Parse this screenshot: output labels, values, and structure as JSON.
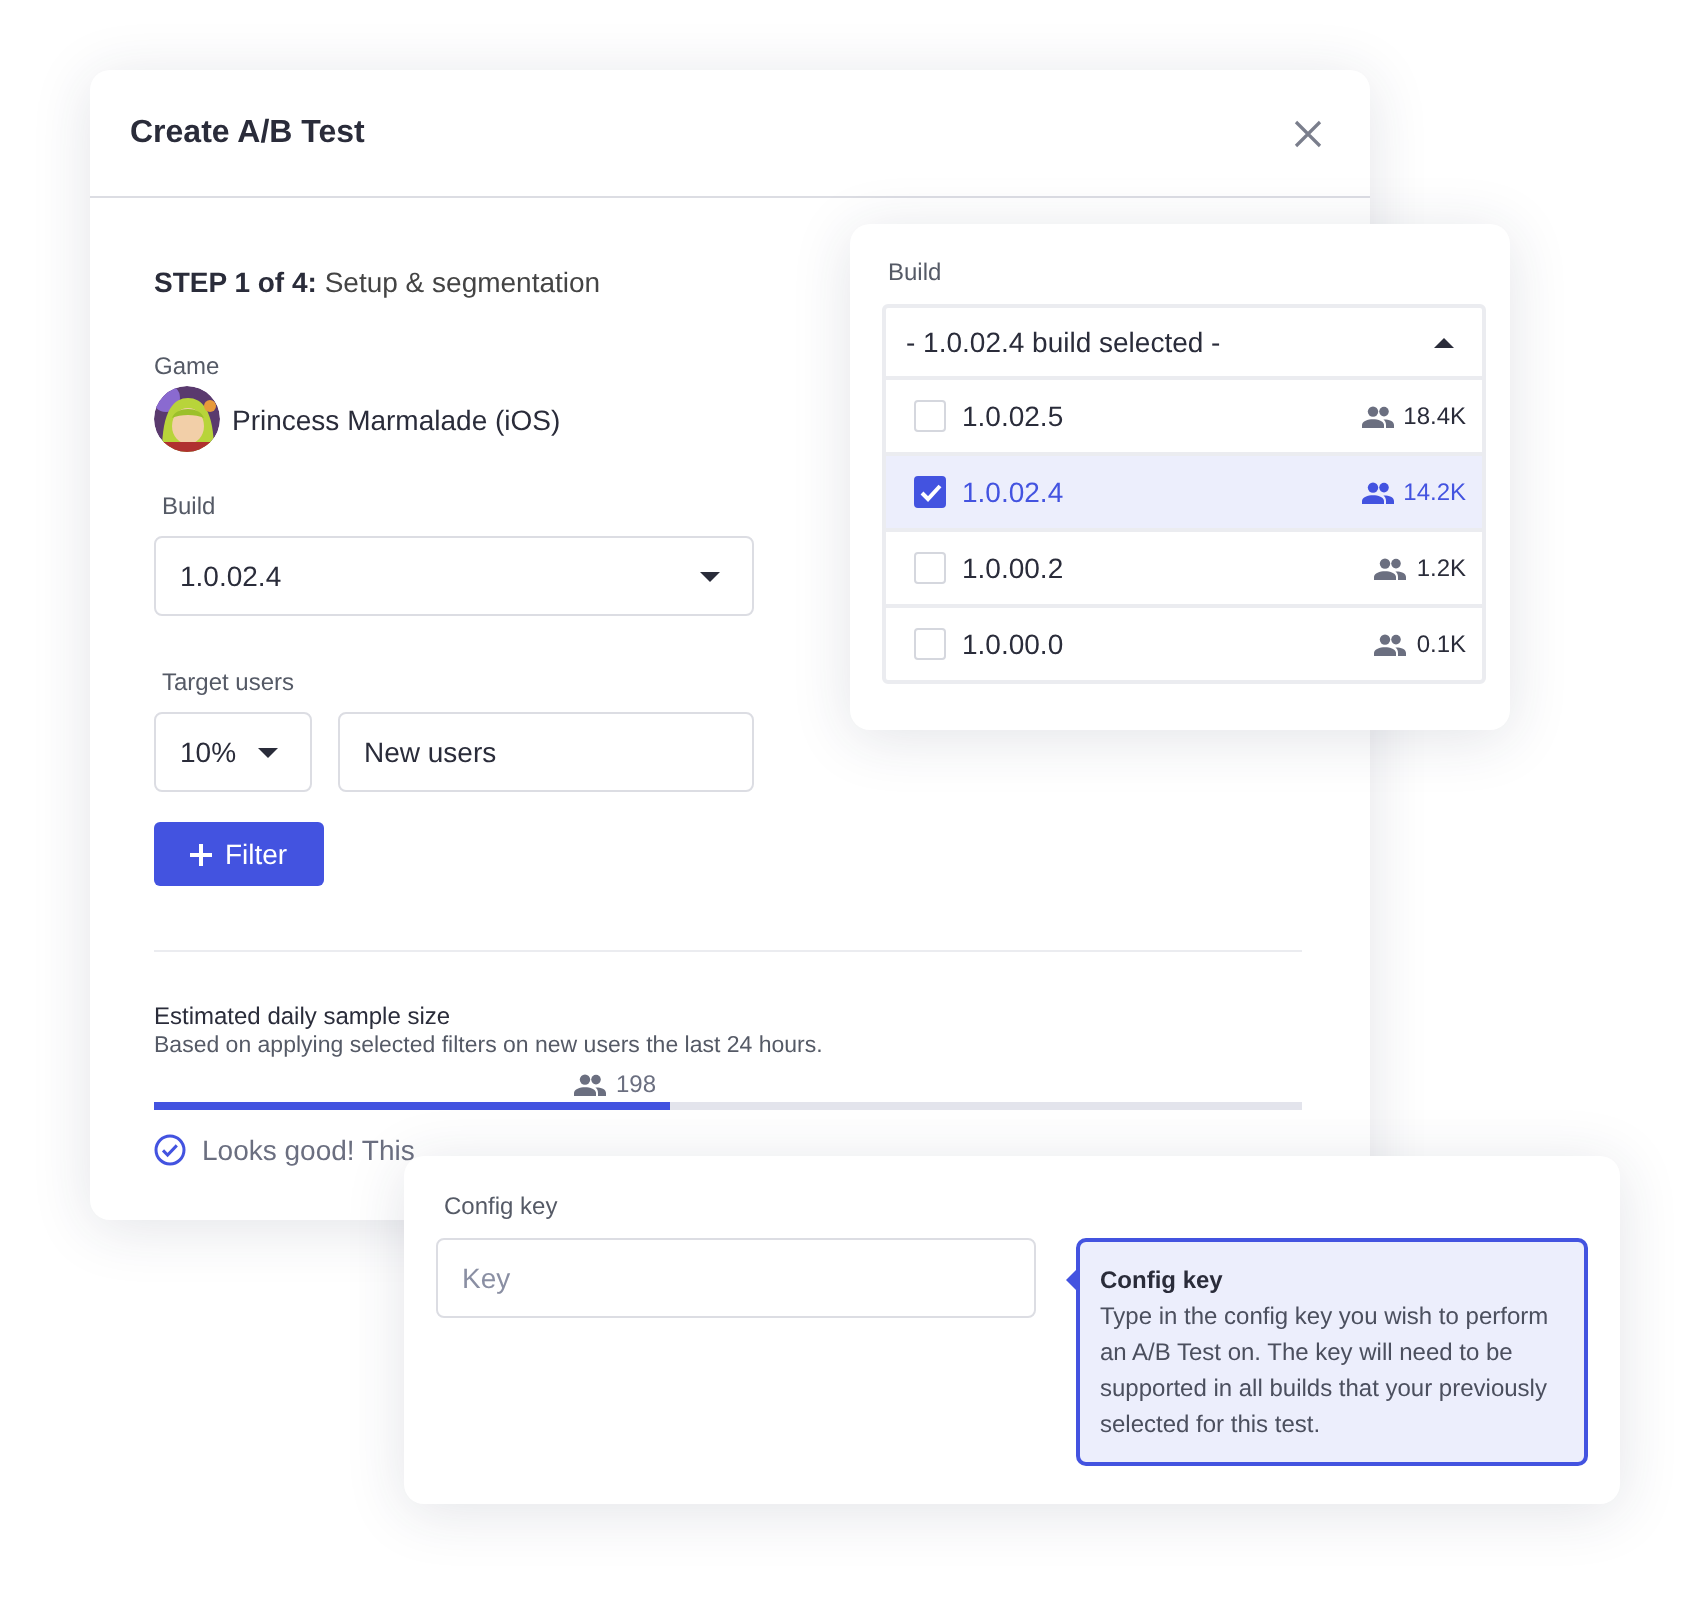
{
  "dialog": {
    "title": "Create A/B Test",
    "step": "**STEP 1 of 4:** Setup & segmentation",
    "game_label": "Game",
    "game_name": "Princess Marmalade (iOS)",
    "build_label": "Build",
    "build_value": "1.0.02.4",
    "target_label": "Target users",
    "percent_value": "10%",
    "segment_value": "New users",
    "filter_button": "Filter",
    "sample": {
      "title": "Estimated daily sample size",
      "subtitle": "Based on applying selected filters on new users the last 24 hours.",
      "count": "198",
      "level": 0.45,
      "status": "Looks good! This"
    }
  },
  "build_dropdown": {
    "label": "Build",
    "summary": "- 1.0.02.4 build selected -",
    "options": [
      {
        "label": "1.0.02.5",
        "count": "18.4K",
        "selected": false
      },
      {
        "label": "1.0.02.4",
        "count": "14.2K",
        "selected": true
      },
      {
        "label": "1.0.00.2",
        "count": "1.2K",
        "selected": false
      },
      {
        "label": "1.0.00.0",
        "count": "0.1K",
        "selected": false
      }
    ]
  },
  "config": {
    "label": "Config key",
    "placeholder": "Key",
    "tooltip_title": "Config key",
    "tooltip_text": "Type in the config key you wish to perform an A/B Test on. The key will need to be supported in all builds that your previously selected for this test."
  }
}
